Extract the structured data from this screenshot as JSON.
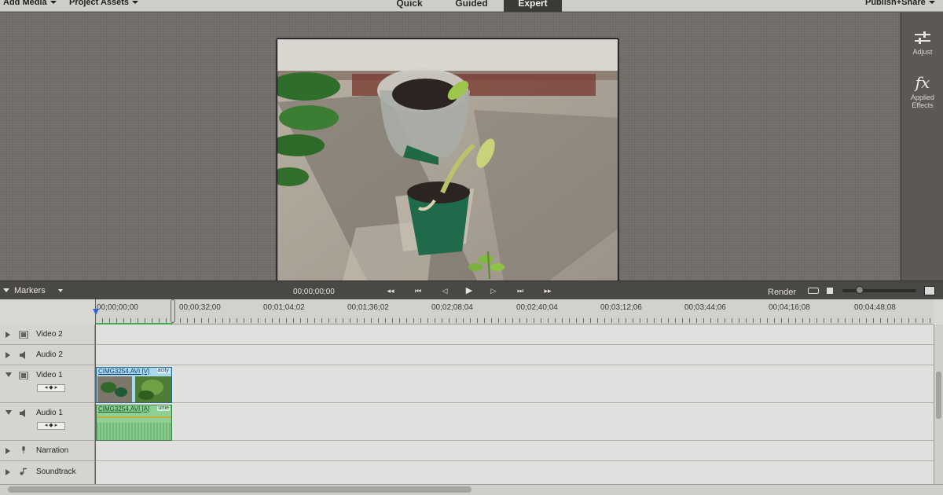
{
  "menubar": {
    "add_media": "Add Media",
    "project_assets": "Project Assets",
    "publish_share": "Publish+Share"
  },
  "modes": {
    "quick": "Quick",
    "guided": "Guided",
    "expert": "Expert",
    "active": "Expert"
  },
  "right_panel": {
    "adjust_label": "Adjust",
    "effects_label_line1": "Applied",
    "effects_label_line2": "Effects",
    "fx_glyph": "fx"
  },
  "timeline_header": {
    "markers_label": "Markers",
    "timecode": "00;00;00;00",
    "render_label": "Render"
  },
  "ruler": {
    "labels": [
      "00;00;00;00",
      "00;00;32;00",
      "00;01;04;02",
      "00;01;36;02",
      "00;02;08;04",
      "00;02;40;04",
      "00;03;12;06",
      "00;03;44;06",
      "00;04;16;08",
      "00;04;48;08"
    ]
  },
  "tracks": [
    {
      "name": "Video 2",
      "type": "video",
      "expanded": false
    },
    {
      "name": "Audio 2",
      "type": "audio",
      "expanded": false
    },
    {
      "name": "Video 1",
      "type": "video",
      "expanded": true
    },
    {
      "name": "Audio 1",
      "type": "audio",
      "expanded": true
    },
    {
      "name": "Narration",
      "type": "narration",
      "expanded": false
    },
    {
      "name": "Soundtrack",
      "type": "soundtrack",
      "expanded": false
    }
  ],
  "clips": {
    "video_clip_title": "CIMG3254.AVI [V]",
    "video_clip_fx": "acity",
    "audio_clip_title": "CIMG3254.AVI [A]",
    "audio_clip_fx": "ume"
  },
  "colors": {
    "expert_tab": "#3c3a37",
    "playhead": "#e02a1e",
    "work_area": "#3ab24a",
    "video_clip": "#a9d9ef",
    "audio_clip": "#8fcf95"
  }
}
